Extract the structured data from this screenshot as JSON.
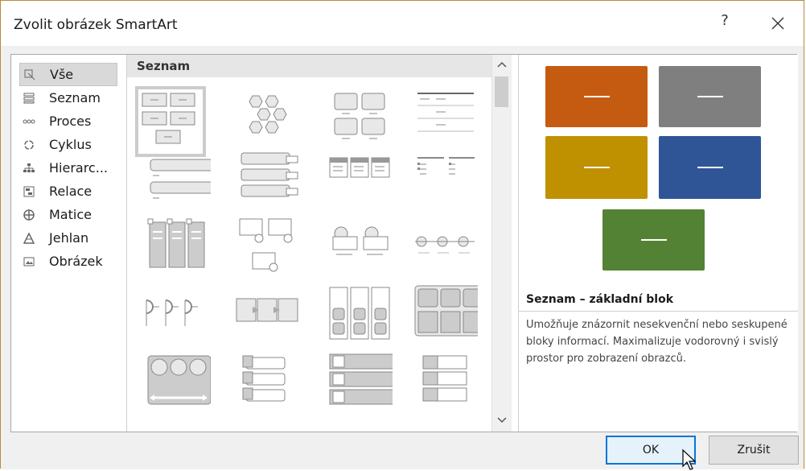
{
  "dialog": {
    "title": "Zvolit obrázek SmartArt",
    "help_label": "?",
    "close_icon": "close-icon"
  },
  "categories": [
    {
      "label": "Vše",
      "icon": "all-icon",
      "selected": true
    },
    {
      "label": "Seznam",
      "icon": "list-icon"
    },
    {
      "label": "Proces",
      "icon": "process-icon"
    },
    {
      "label": "Cyklus",
      "icon": "cycle-icon"
    },
    {
      "label": "Hierarc...",
      "icon": "hierarchy-icon"
    },
    {
      "label": "Relace",
      "icon": "relationship-icon"
    },
    {
      "label": "Matice",
      "icon": "matrix-icon"
    },
    {
      "label": "Jehlan",
      "icon": "pyramid-icon"
    },
    {
      "label": "Obrázek",
      "icon": "picture-icon"
    }
  ],
  "gallery": {
    "section_title": "Seznam"
  },
  "preview": {
    "colors": [
      "#c55a11",
      "#7f7f7f",
      "#bf9000",
      "#2f5597",
      "#548235"
    ],
    "title": "Seznam – základní blok",
    "description": "Umožňuje znázornit nesekvenční nebo seskupené bloky informací. Maximalizuje vodorovný i svislý prostor pro zobrazení obrazců."
  },
  "buttons": {
    "ok": "OK",
    "cancel": "Zrušit"
  }
}
